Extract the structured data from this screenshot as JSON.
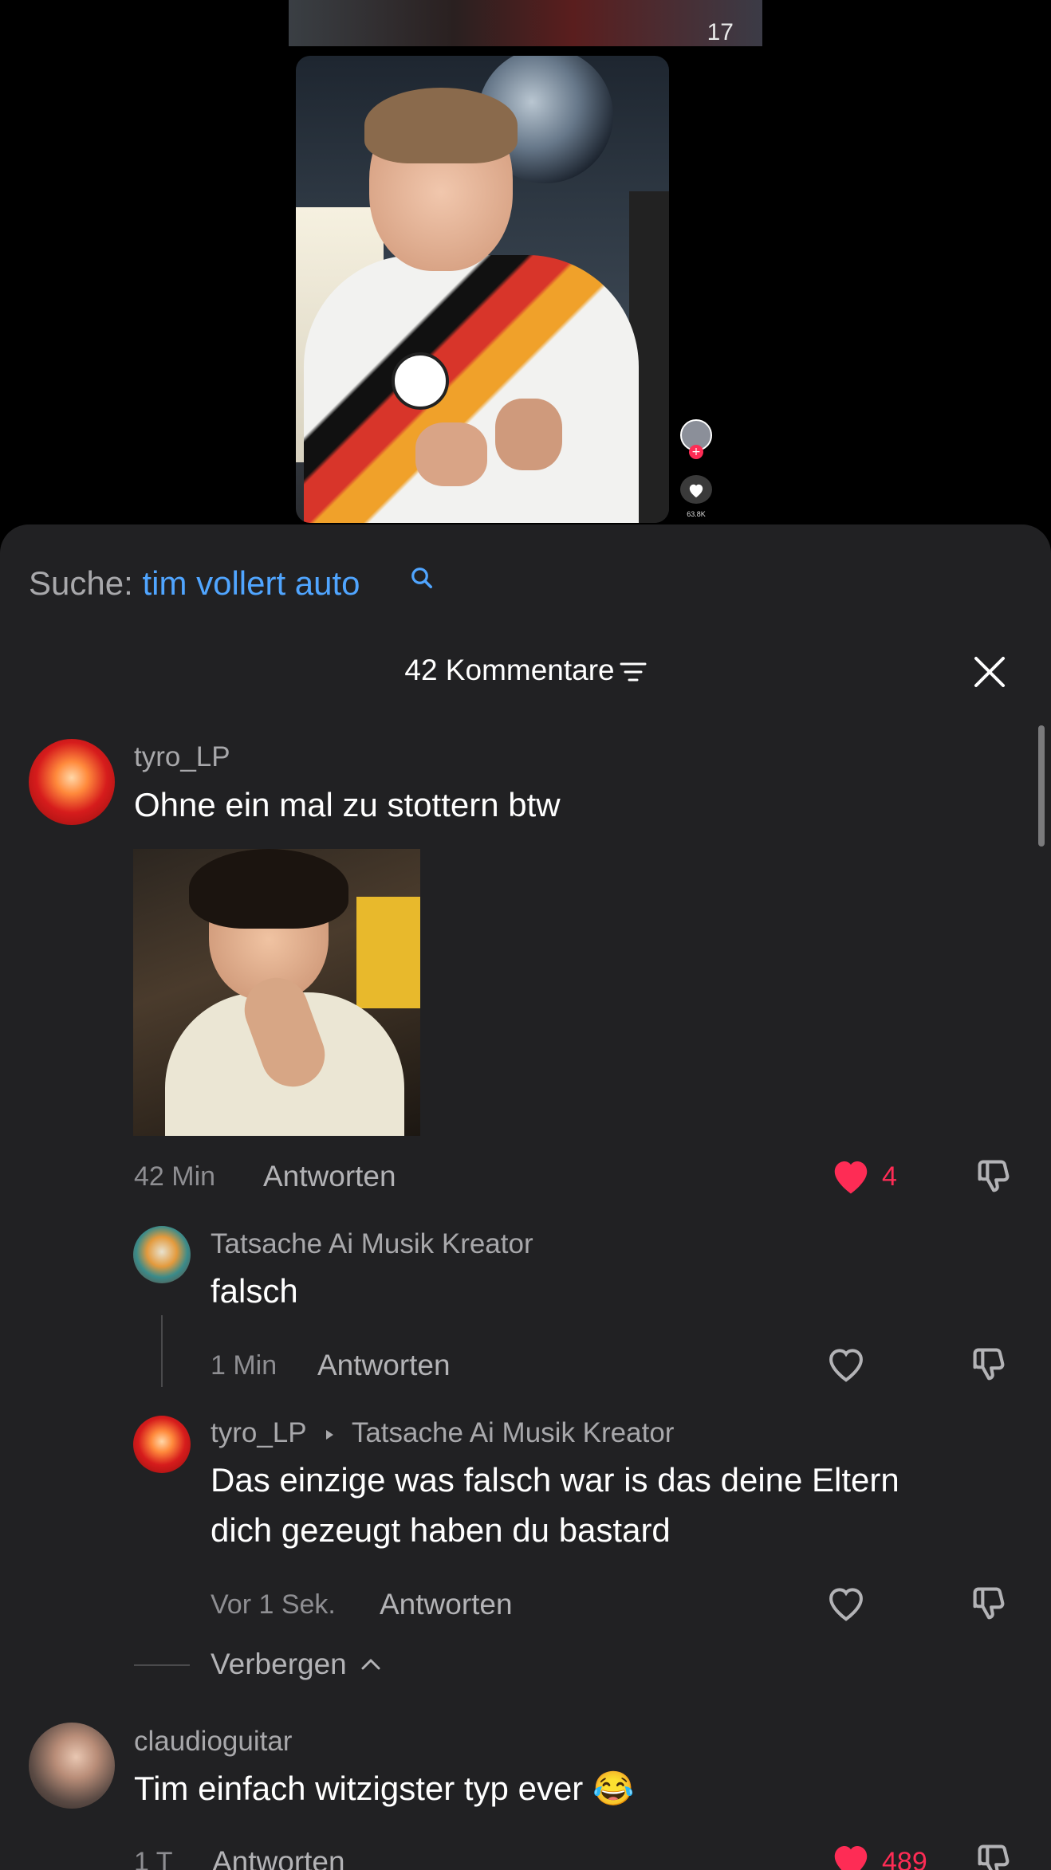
{
  "video": {
    "strip_number": "17",
    "like_count": "63.8K"
  },
  "search": {
    "prefix": "Suche:",
    "query": "tim vollert auto"
  },
  "header": {
    "comment_count_label": "42 Kommentare"
  },
  "comments": [
    {
      "username": "tyro_LP",
      "text": "Ohne ein mal zu stottern btw",
      "time": "42 Min",
      "reply_label": "Antworten",
      "like_count": "4",
      "liked": true
    },
    {
      "username": "Tatsache Ai Musik Kreator",
      "text": "falsch",
      "time": "1 Min",
      "reply_label": "Antworten",
      "liked": false
    },
    {
      "username": "tyro_LP",
      "reply_to": "Tatsache Ai Musik Kreator",
      "text_line1": "Das einzige was falsch war is das deine Eltern",
      "text_line2": "dich gezeugt haben du bastard",
      "time": "Vor 1 Sek.",
      "reply_label": "Antworten",
      "liked": false
    },
    {
      "username": "claudioguitar",
      "text": "Tim einfach witzigster typ ever 😂",
      "time": "1 T",
      "reply_label": "Antworten",
      "like_count": "489",
      "liked": true
    }
  ],
  "hide_replies_label": "Verbergen",
  "colors": {
    "sheet_bg": "#212123",
    "accent_like": "#fe2c55",
    "search_link": "#50a5ff"
  }
}
